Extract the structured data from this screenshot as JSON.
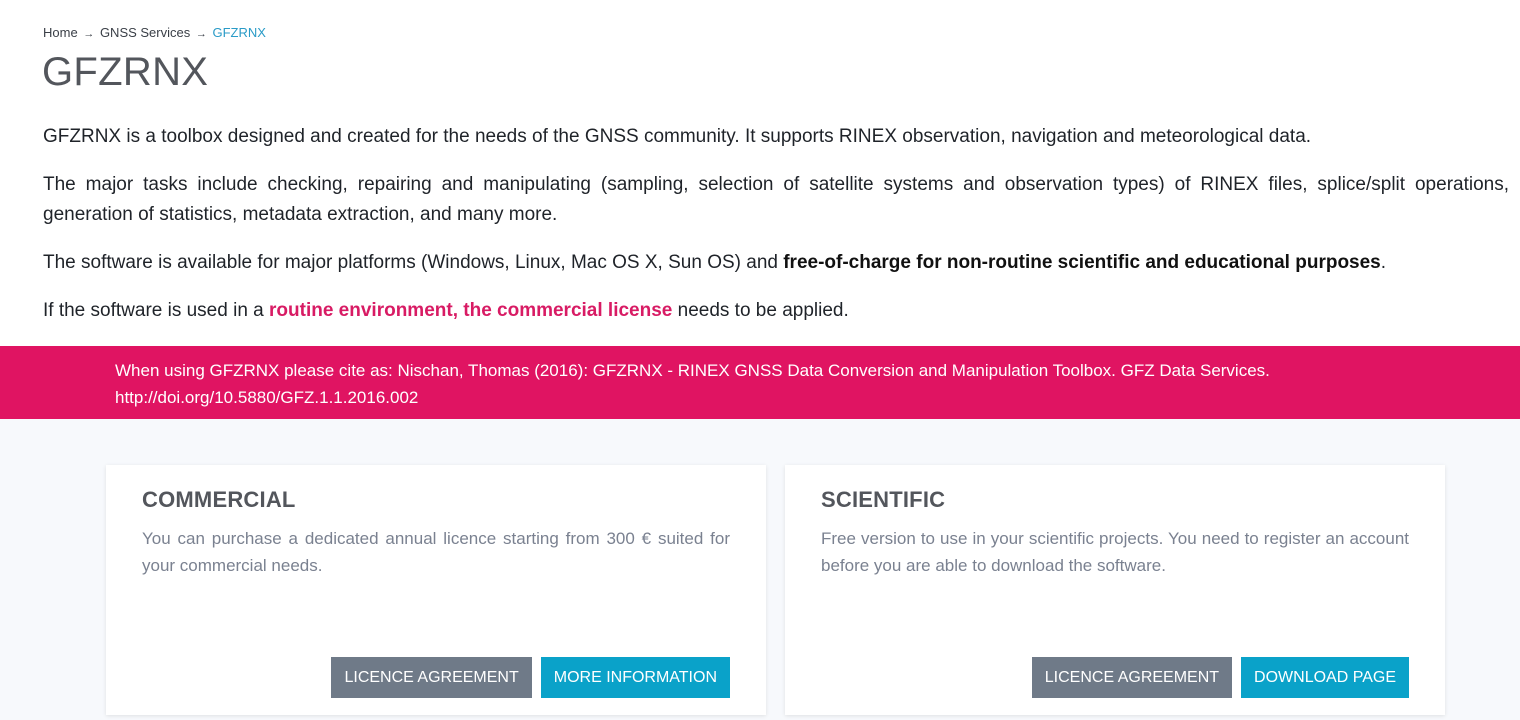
{
  "breadcrumb": {
    "items": [
      "Home",
      "GNSS Services"
    ],
    "separator": "→",
    "current": "GFZRNX"
  },
  "page_title": "GFZRNX",
  "intro": {
    "p1": "GFZRNX is a toolbox designed and created for the needs of the GNSS community. It supports RINEX observation, navigation and meteorological data.",
    "p2": "The major tasks include checking, repairing and manipulating (sampling, selection of satellite systems and observation types) of RINEX files, splice/split operations, generation of statistics, metadata extraction, and many more.",
    "p3_before": "The software is available for major platforms (Windows, Linux, Mac OS X, Sun OS) and ",
    "p3_bold": "free-of-charge for non-routine scientific and educational purposes",
    "p3_after": ".",
    "p4_before": "If the software is used in a ",
    "p4_link": "routine environment, the commercial license",
    "p4_after": " needs to be applied."
  },
  "citation": {
    "line1": "When using GFZRNX please cite as: Nischan, Thomas (2016): GFZRNX - RINEX GNSS Data Conversion and Manipulation Toolbox. GFZ Data Services.",
    "line2": "http://doi.org/10.5880/GFZ.1.1.2016.002"
  },
  "cards": {
    "commercial": {
      "title": "COMMERCIAL",
      "description": "You can purchase a dedicated annual licence starting from 300 € suited for your commercial needs.",
      "button_left": "LICENCE AGREEMENT",
      "button_right": "MORE INFORMATION"
    },
    "scientific": {
      "title": "SCIENTIFIC",
      "description": "Free version to use in your scientific projects. You need to register an account before you are able to download the software.",
      "button_left": "LICENCE AGREEMENT",
      "button_right": "DOWNLOAD PAGE"
    }
  },
  "colors": {
    "accent_pink": "#e01462",
    "link_pink": "#d81b64",
    "button_blue": "#0aa2c9",
    "button_grey": "#6f7a88",
    "breadcrumb_current": "#2a9bc7"
  }
}
